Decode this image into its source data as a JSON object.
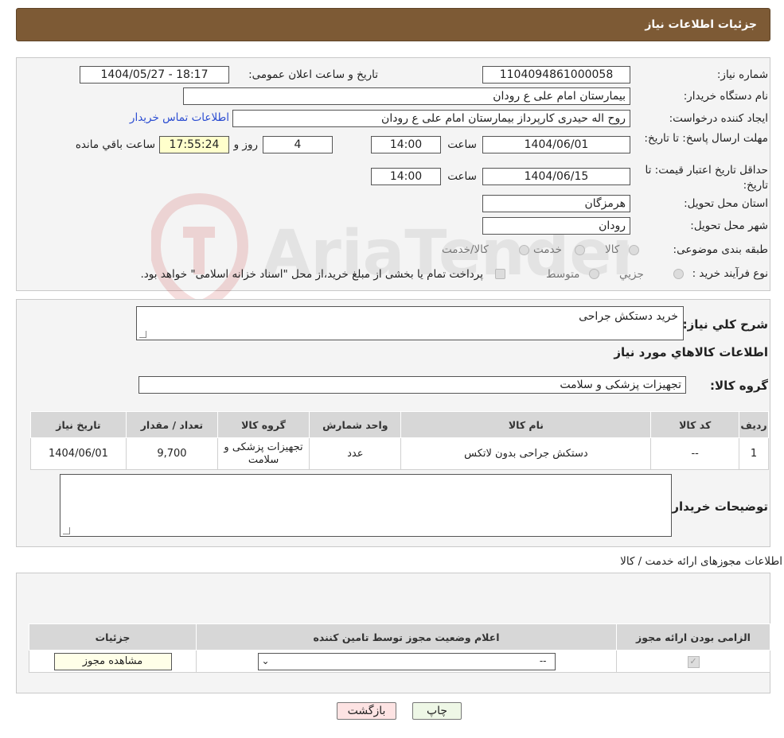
{
  "header": {
    "title": "جزئیات اطلاعات نیاز"
  },
  "form": {
    "need_number_label": "شماره نیاز:",
    "need_number": "1104094861000058",
    "announce_label": "تاریخ و ساعت اعلان عمومی:",
    "announce_value": "1404/05/27 - 18:17",
    "buyer_org_label": "نام دستگاه خریدار:",
    "buyer_org": "بیمارستان امام علی  ع  رودان",
    "creator_label": "ایجاد کننده درخواست:",
    "creator": "روح اله حیدری کارپرداز  بیمارستان امام علی  ع  رودان",
    "contact_link": "اطلاعات تماس خریدار",
    "deadline_label": "مهلت ارسال پاسخ: تا تاریخ:",
    "deadline_date": "1404/06/01",
    "time_label": "ساعت",
    "deadline_time": "14:00",
    "days": "4",
    "days_label": "روز و",
    "remaining_time": "17:55:24",
    "remaining_label": "ساعت باقي مانده",
    "validity_label": "حداقل تاریخ اعتبار قیمت: تا تاریخ:",
    "validity_date": "1404/06/15",
    "validity_time": "14:00",
    "province_label": "استان محل تحویل:",
    "province": "هرمزگان",
    "city_label": "شهر محل تحویل:",
    "city": "رودان",
    "category_label": "طبقه بندی موضوعی:",
    "category_options": [
      "کالا",
      "خدمت",
      "کالا/خدمت"
    ],
    "process_label": "نوع فرآیند خرید :",
    "process_options": [
      "جزیي",
      "متوسط"
    ],
    "process_note": "پرداخت تمام یا بخشی از مبلغ خرید،از محل \"اسناد خزانه اسلامی\" خواهد بود."
  },
  "description": {
    "label": "شرح کلي نياز:",
    "value": "خرید دستکش جراحی",
    "items_title": "اطلاعات کالاهاي مورد نياز",
    "group_label": "گروه کالا:",
    "group_value": "تجهیزات پزشکی و سلامت"
  },
  "items_table": {
    "headers": [
      "رديف",
      "کد کالا",
      "نام کالا",
      "واحد شمارش",
      "گروه کالا",
      "تعداد / مقدار",
      "تاریخ نیاز"
    ],
    "rows": [
      [
        "1",
        "--",
        "دستکش جراحی بدون لاتکس",
        "عدد",
        "تجهیزات پزشکی و سلامت",
        "9,700",
        "1404/06/01"
      ]
    ]
  },
  "buyer_notes": {
    "label": "توضیحات خریدار:"
  },
  "permits": {
    "title": "اطلاعات مجوزهای ارائه خدمت / کالا",
    "headers": [
      "الزامی بودن ارائه مجوز",
      "اعلام وضعیت مجوز توسط تامین کننده",
      "جزئیات"
    ],
    "select_value": "--",
    "view_button": "مشاهده مجوز"
  },
  "buttons": {
    "print": "چاپ",
    "back": "بازگشت"
  },
  "watermark": {
    "text": "AriaTender.neT"
  },
  "colors": {
    "header_bg": "#7d5a35",
    "link": "#2a4cd1",
    "back_btn": "#fde3e3",
    "print_btn": "#eef7e6"
  }
}
